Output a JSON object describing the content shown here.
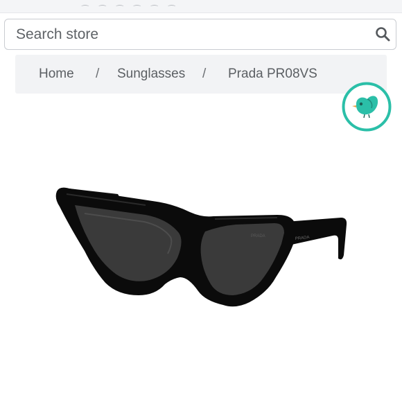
{
  "search": {
    "placeholder": "Search store",
    "icon": "search-icon"
  },
  "breadcrumb": {
    "items": [
      "Home",
      "Sunglasses",
      "Prada PR08VS"
    ],
    "separator": "/"
  },
  "badge": {
    "icon": "bird-icon",
    "color": "#2bbfa8"
  },
  "product": {
    "image": "black cat-eye sunglasses",
    "temple_text": "PRADA",
    "lens_text": "PRADA"
  }
}
